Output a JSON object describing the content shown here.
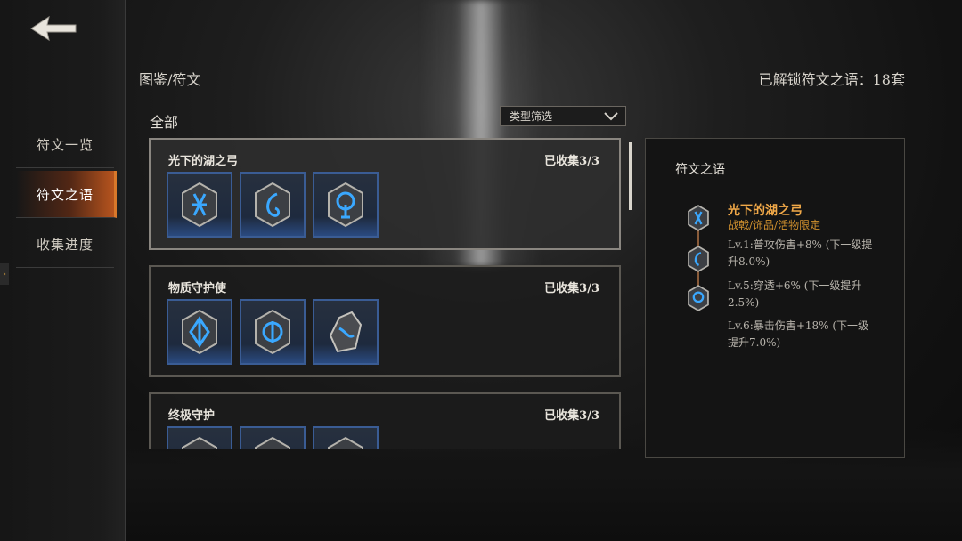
{
  "sidebar": {
    "items": [
      {
        "label": "符文一览",
        "active": false
      },
      {
        "label": "符文之语",
        "active": true
      },
      {
        "label": "收集进度",
        "active": false
      }
    ],
    "back_icon": "back-arrow-icon",
    "toggle_glyph": "›"
  },
  "header": {
    "breadcrumb": "图鉴/符文",
    "unlocked_text": "已解锁符文之语：18套"
  },
  "list": {
    "section_title": "全部",
    "filter_label": "类型筛选",
    "cards": [
      {
        "name": "光下的湖之弓",
        "count": "已收集3/3",
        "runes": [
          "rune-x",
          "rune-swirl",
          "rune-keyhole"
        ]
      },
      {
        "name": "物质守护使",
        "count": "已收集3/3",
        "runes": [
          "rune-diamond",
          "rune-orb",
          "rune-shard"
        ]
      },
      {
        "name": "终极守护",
        "count": "已收集3/3",
        "runes": [
          "rune-plain",
          "rune-plain",
          "rune-plain"
        ]
      }
    ]
  },
  "detail": {
    "title": "符文之语",
    "name": "光下的湖之弓",
    "subtitle": "战戟/饰品/活物限定",
    "effects": [
      "Lv.1:普攻伤害+8% (下一级提升8.0%)",
      "Lv.5:穿透+6% (下一级提升2.5%)",
      "Lv.6:暴击伤害+18% (下一级提升7.0%)"
    ]
  },
  "colors": {
    "accent": "#d9782a",
    "gold_text": "#f0a848",
    "rune_glow": "#3aa8ff"
  }
}
